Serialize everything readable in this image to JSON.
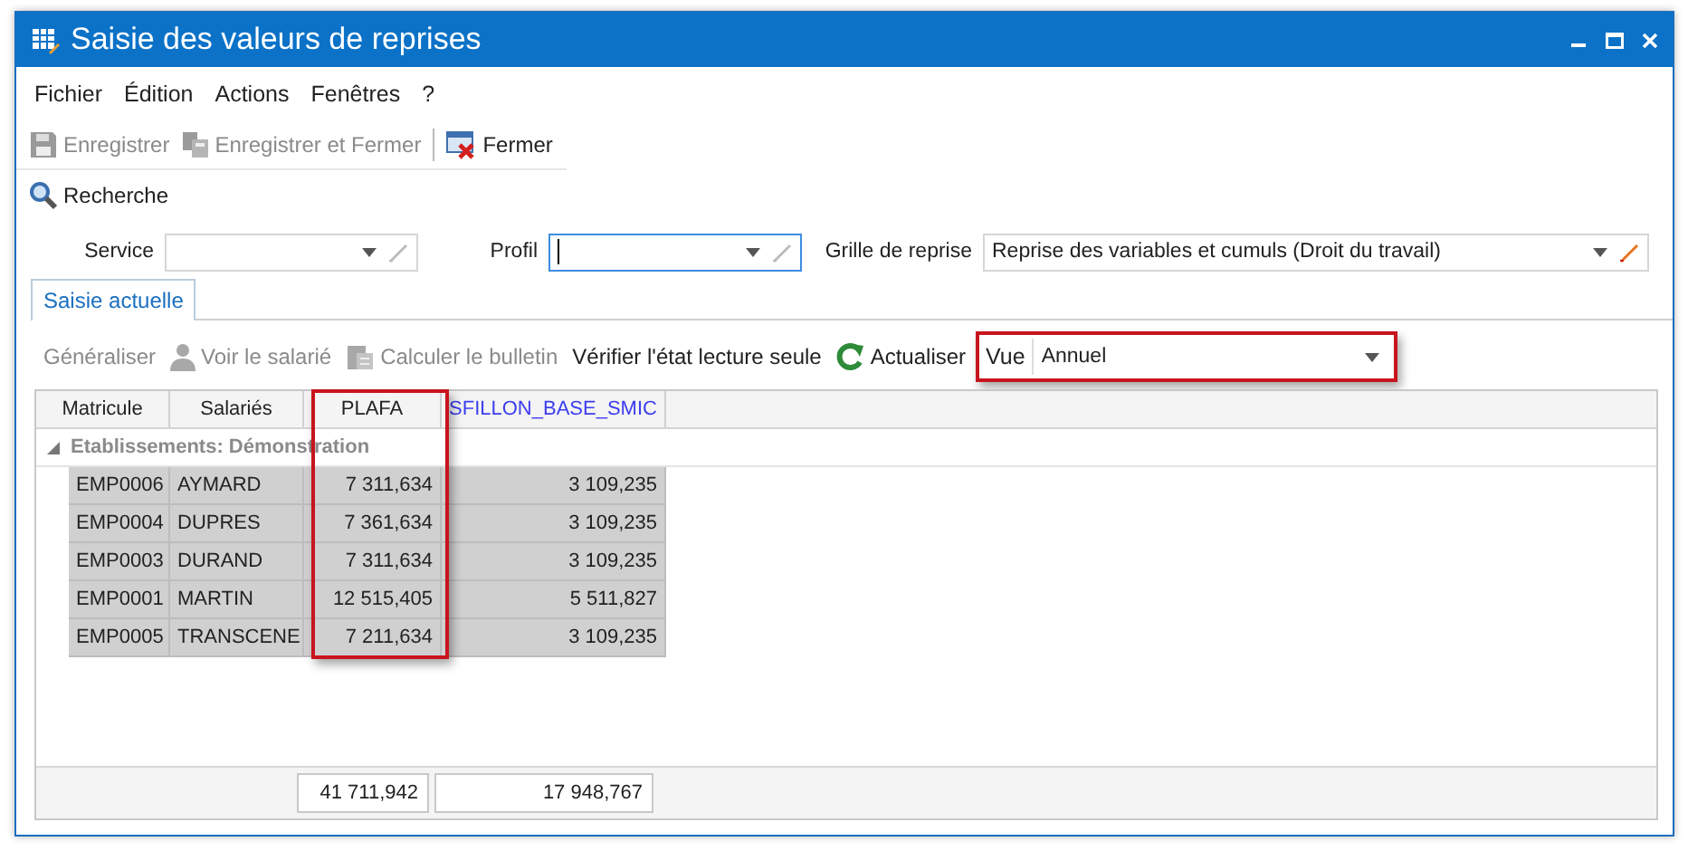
{
  "window": {
    "title": "Saisie des valeurs de reprises"
  },
  "menu": [
    "Fichier",
    "Édition",
    "Actions",
    "Fenêtres",
    "?"
  ],
  "toolbar": [
    {
      "label": "Enregistrer",
      "kind": "save",
      "disabled": true
    },
    {
      "label": "Enregistrer et Fermer",
      "kind": "save-close",
      "disabled": true
    },
    {
      "label": "Fermer",
      "kind": "close",
      "disabled": false
    }
  ],
  "search_button": {
    "label": "Recherche"
  },
  "filters": [
    {
      "label": "Service",
      "focused": false,
      "edit_enabled": false
    },
    {
      "label": "Profil",
      "focused": true,
      "edit_enabled": false
    },
    {
      "label": "Grille de reprise",
      "value": "Reprise des variables et cumuls (Droit du travail)",
      "focused": false,
      "edit_enabled": true
    }
  ],
  "tabs": [
    {
      "label": "Saisie actuelle",
      "selected": true
    }
  ],
  "actions": [
    {
      "label": "Généraliser",
      "kind": "plain",
      "disabled": true
    },
    {
      "label": "Voir le salarié",
      "kind": "person",
      "disabled": true
    },
    {
      "label": "Calculer le bulletin",
      "kind": "calculator",
      "disabled": true
    },
    {
      "label": "Vérifier l'état lecture seule",
      "kind": "plain",
      "disabled": false
    },
    {
      "label": "Actualiser",
      "kind": "refresh",
      "disabled": false
    }
  ],
  "view": {
    "label": "Vue",
    "value": "Annuel",
    "highlighted": true
  },
  "table": {
    "columns": [
      {
        "label": "Matricule",
        "link": false,
        "highlighted": false
      },
      {
        "label": "Salariés",
        "link": false,
        "highlighted": false
      },
      {
        "label": "PLAFA",
        "link": false,
        "highlighted": true
      },
      {
        "label": "SFILLON_BASE_SMIC",
        "link": true,
        "highlighted": false
      }
    ],
    "group": {
      "label": "Etablissements: Démonstration",
      "expanded": true
    },
    "rows": [
      {
        "cells": [
          "EMP0006",
          "AYMARD",
          "7 311,634",
          "3 109,235"
        ],
        "selected": true
      },
      {
        "cells": [
          "EMP0004",
          "DUPRES",
          "7 361,634",
          "3 109,235"
        ],
        "selected": true
      },
      {
        "cells": [
          "EMP0003",
          "DURAND",
          "7 311,634",
          "3 109,235"
        ],
        "selected": true
      },
      {
        "cells": [
          "EMP0001",
          "MARTIN",
          "12 515,405",
          "5 511,827"
        ],
        "selected": true
      },
      {
        "cells": [
          "EMP0005",
          "TRANSCENE",
          "7 211,634",
          "3 109,235"
        ],
        "selected": true
      }
    ],
    "totals": [
      "41 711,942",
      "17 948,767"
    ]
  }
}
